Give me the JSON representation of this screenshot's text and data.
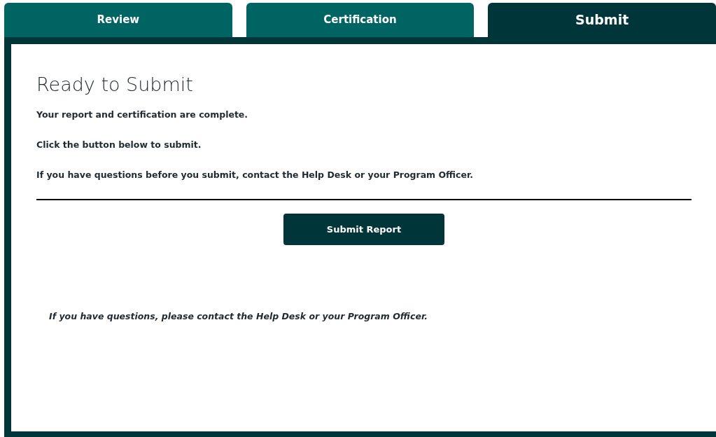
{
  "tabs": [
    {
      "label": "Review",
      "selected": false
    },
    {
      "label": "Certification",
      "selected": false
    },
    {
      "label": "Submit",
      "selected": true
    }
  ],
  "heading": "Ready to Submit",
  "paragraphs": [
    "Your report and certification are complete.",
    "Click the button below to submit.",
    "If you have questions before you submit, contact the Help Desk or your Program Officer."
  ],
  "button": "Submit Report",
  "footer_note": "If you have questions, please contact the Help Desk or your Program Officer."
}
